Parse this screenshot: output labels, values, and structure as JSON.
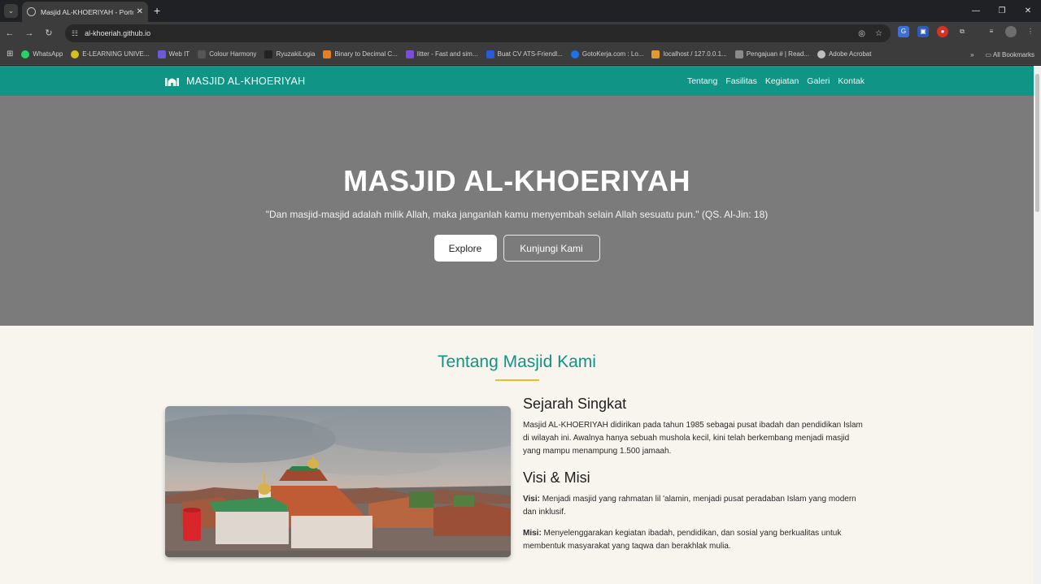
{
  "browser": {
    "tab_title": "Masjid AL-KHOERIYAH - Portofolio",
    "url": "al-khoeriah.github.io",
    "bookmarks": [
      {
        "label": "WhatsApp",
        "color": "#25d366"
      },
      {
        "label": "E-LEARNING UNIVE...",
        "color": "#d4c21a"
      },
      {
        "label": "Web IT",
        "color": "#6b5bd6"
      },
      {
        "label": "Colour Harmony",
        "color": "#555555"
      },
      {
        "label": "RyuzakiLogia",
        "color": "#222222"
      },
      {
        "label": "Binary to Decimal C...",
        "color": "#e67e22"
      },
      {
        "label": "litter - Fast and sim...",
        "color": "#7b4dd8"
      },
      {
        "label": "Buat CV ATS-Friendl...",
        "color": "#2a5bd7"
      },
      {
        "label": "GotoKerja.com : Lo...",
        "color": "#1a73e8"
      },
      {
        "label": "localhost / 127.0.0.1...",
        "color": "#e29a2e"
      },
      {
        "label": "Pengajuan # | Read...",
        "color": "#8a8a8a"
      },
      {
        "label": "Adobe Acrobat",
        "color": "#bdbdbd"
      }
    ],
    "all_bookmarks": "All Bookmarks"
  },
  "navbar": {
    "brand": "MASJID AL-KHOERIYAH",
    "links": [
      "Tentang",
      "Fasilitas",
      "Kegiatan",
      "Galeri",
      "Kontak"
    ]
  },
  "hero": {
    "title": "MASJID AL-KHOERIYAH",
    "quote": "\"Dan masjid-masjid adalah milik Allah, maka janganlah kamu menyembah selain Allah sesuatu pun.\" (QS. Al-Jin: 18)",
    "primary_button": "Explore",
    "secondary_button": "Kunjungi Kami"
  },
  "about": {
    "section_title": "Tentang Masjid Kami",
    "history_title": "Sejarah Singkat",
    "history_text": "Masjid AL-KHOERIYAH didirikan pada tahun 1985 sebagai pusat ibadah dan pendidikan Islam di wilayah ini. Awalnya hanya sebuah mushola kecil, kini telah berkembang menjadi masjid yang mampu menampung 1.500 jamaah.",
    "vision_mission_title": "Visi & Misi",
    "vision_label": "Visi:",
    "vision_text": " Menjadi masjid yang rahmatan lil 'alamin, menjadi pusat peradaban Islam yang modern dan inklusif.",
    "mission_label": "Misi:",
    "mission_text": " Menyelenggarakan kegiatan ibadah, pendidikan, dan sosial yang berkualitas untuk membentuk masyarakat yang taqwa dan berakhlak mulia."
  },
  "colors": {
    "primary": "#0f9485",
    "accent": "#e5c02a",
    "hero_overlay": "#7b7b7b",
    "page_bg": "#f8f5ef"
  }
}
